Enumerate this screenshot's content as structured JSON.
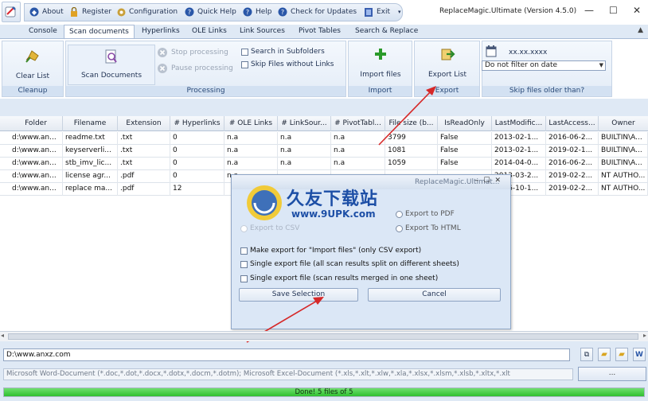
{
  "quick_access": {
    "about": "About",
    "register": "Register",
    "configuration": "Configuration",
    "quick_help": "Quick Help",
    "help": "Help",
    "check_updates": "Check for Updates",
    "exit": "Exit"
  },
  "window": {
    "title": "ReplaceMagic.Ultimate (Version 4.5.0)"
  },
  "tabs": [
    "Console",
    "Scan documents",
    "Hyperlinks",
    "OLE Links",
    "Link Sources",
    "Pivot Tables",
    "Search & Replace"
  ],
  "ribbon": {
    "cleanup": {
      "clear_list": "Clear List",
      "label": "Cleanup"
    },
    "processing": {
      "scan_documents": "Scan Documents",
      "stop_processing": "Stop processing",
      "pause_processing": "Pause processing",
      "search_subfolders": "Search in Subfolders",
      "skip_files_without_links": "Skip Files without Links",
      "label": "Processing"
    },
    "import": {
      "import_files": "Import files",
      "label": "Import"
    },
    "export": {
      "export_list": "Export List",
      "label": "Export"
    },
    "skip_older": {
      "date_text": "xx.xx.xxxx",
      "date_filter": "Do not filter on date",
      "label": "Skip files older than?"
    }
  },
  "table": {
    "columns": [
      "Folder",
      "Filename",
      "Extension",
      "# Hyperlinks",
      "# OLE Links",
      "# LinkSour...",
      "# PivotTabl...",
      "File size (b...",
      "IsReadOnly",
      "LastModific...",
      "LastAccess...",
      "Owner"
    ],
    "rows": [
      [
        "d:\\www.an...",
        "readme.txt",
        ".txt",
        "0",
        "n.a",
        "n.a",
        "n.a",
        "3799",
        "False",
        "2013-02-1...",
        "2016-06-2...",
        "BUILTIN\\A..."
      ],
      [
        "d:\\www.an...",
        "keyserverli...",
        ".txt",
        "0",
        "n.a",
        "n.a",
        "n.a",
        "1081",
        "False",
        "2013-02-1...",
        "2019-02-1...",
        "BUILTIN\\A..."
      ],
      [
        "d:\\www.an...",
        "stb_imv_lic...",
        ".txt",
        "0",
        "n.a",
        "n.a",
        "n.a",
        "1059",
        "False",
        "2014-04-0...",
        "2016-06-2...",
        "BUILTIN\\A..."
      ],
      [
        "d:\\www.an...",
        "license agr...",
        ".pdf",
        "0",
        "n.a",
        "",
        "",
        "",
        "",
        "2013-03-2...",
        "2019-02-2...",
        "NT AUTHO..."
      ],
      [
        "d:\\www.an...",
        "replace ma...",
        ".pdf",
        "12",
        "",
        "",
        "",
        "",
        "",
        "2016-10-1...",
        "2019-02-2...",
        "NT AUTHO..."
      ]
    ]
  },
  "dialog": {
    "title": "ReplaceMagic.Ultimat...",
    "export_pdf": "Export to PDF",
    "export_html": "Export To HTML",
    "export_csv": "Export to CSV",
    "opt1": "Make export for \"Import files\" (only CSV export)",
    "opt2": "Single export file (all scan results split on different sheets)",
    "opt3": "Single export file (scan results merged in one sheet)",
    "save": "Save Selection",
    "cancel": "Cancel"
  },
  "watermark": {
    "brand": "久友下载站",
    "url": "www.9UPK.com"
  },
  "bottom": {
    "path": "D:\\www.anxz.com",
    "filter": "Microsoft Word-Document (*.doc,*.dot,*.docx,*.dotx,*.docm,*.dotm); Microsoft Excel-Document (*.xls,*.xlt,*.xlw,*.xla,*.xlsx,*.xlsm,*.xlsb,*.xltx,*.xlt",
    "dots": "...",
    "status": "Done! 5 files of 5",
    "progress_percent": 100
  },
  "colors": {
    "accent": "#2a4a78",
    "progress": "#2fbf2f",
    "arrow": "#d62828"
  }
}
